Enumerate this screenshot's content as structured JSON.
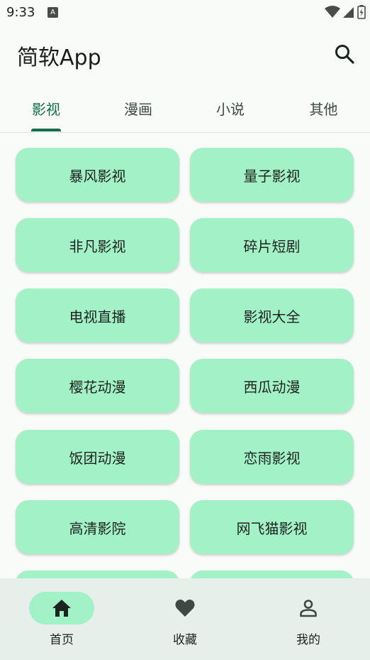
{
  "status_bar": {
    "time": "9:33",
    "notification_icon": "A"
  },
  "app_bar": {
    "title": "简软App",
    "search_icon": "search-icon"
  },
  "tabs": [
    {
      "label": "影视",
      "active": true
    },
    {
      "label": "漫画",
      "active": false
    },
    {
      "label": "小说",
      "active": false
    },
    {
      "label": "其他",
      "active": false
    }
  ],
  "sources": [
    {
      "label": "暴风影视"
    },
    {
      "label": "量子影视"
    },
    {
      "label": "非凡影视"
    },
    {
      "label": "碎片短剧"
    },
    {
      "label": "电视直播"
    },
    {
      "label": "影视大全"
    },
    {
      "label": "樱花动漫"
    },
    {
      "label": "西瓜动漫"
    },
    {
      "label": "饭团动漫"
    },
    {
      "label": "恋雨影视"
    },
    {
      "label": "高清影院"
    },
    {
      "label": "网飞猫影视"
    },
    {
      "label": ""
    },
    {
      "label": ""
    }
  ],
  "bottom_nav": [
    {
      "label": "首页",
      "icon": "home-icon",
      "active": true
    },
    {
      "label": "收藏",
      "icon": "heart-icon",
      "active": false
    },
    {
      "label": "我的",
      "icon": "person-icon",
      "active": false
    }
  ],
  "colors": {
    "accent": "#146c4f",
    "card": "#a3f2c7",
    "nav_background": "#e6efe9"
  }
}
